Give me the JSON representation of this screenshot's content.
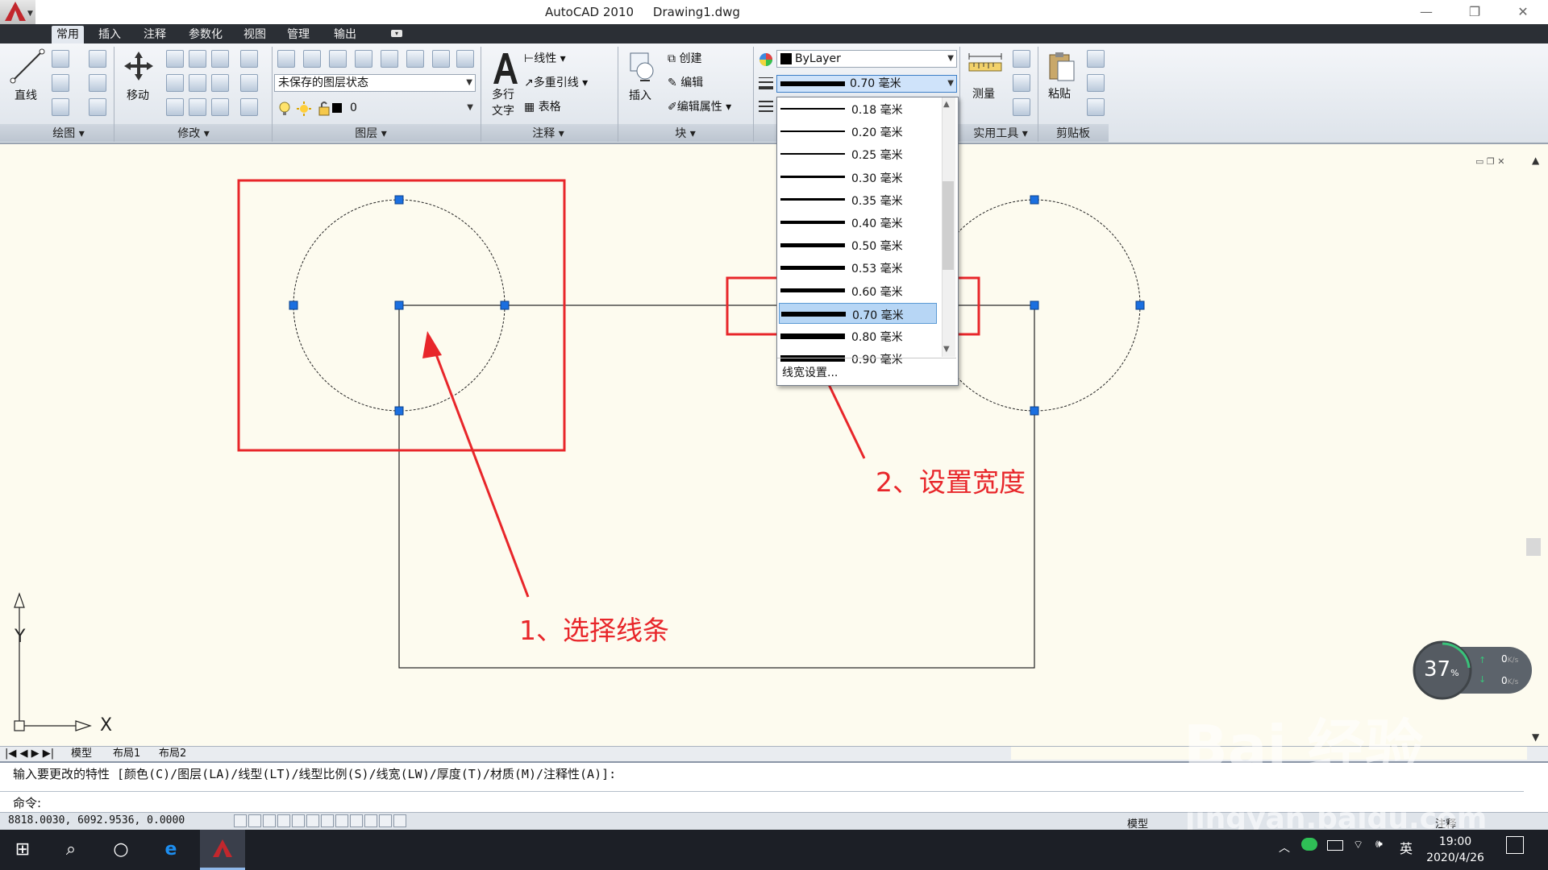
{
  "window": {
    "title": "AutoCAD 2010     Drawing1.dwg",
    "minimize": "—",
    "restore": "❐",
    "close": "✕"
  },
  "ribbon_tabs": [
    "常用",
    "插入",
    "注释",
    "参数化",
    "视图",
    "管理",
    "输出"
  ],
  "ribbon": {
    "draw": {
      "line_label": "直线",
      "panel_label": "绘图"
    },
    "modify": {
      "move_label": "移动",
      "panel_label": "修改"
    },
    "layers": {
      "state_combo": "未保存的图层状态",
      "layer_combo": "0",
      "panel_label": "图层"
    },
    "annotation": {
      "mtext_label_1": "多行",
      "mtext_label_2": "文字",
      "linear_label": "线性",
      "mleader_label": "多重引线",
      "table_label": "表格",
      "panel_label": "注释"
    },
    "block": {
      "insert_label": "插入",
      "create_label": "创建",
      "edit_label": "编辑",
      "edit_attr_label": "编辑属性",
      "panel_label": "块"
    },
    "properties": {
      "color_combo": "ByLayer",
      "lineweight_combo": "0.70 毫米"
    },
    "utilities": {
      "measure_label": "测量",
      "panel_label": "实用工具"
    },
    "clipboard": {
      "paste_label": "粘贴",
      "panel_label": "剪贴板"
    }
  },
  "lineweight_dropdown": {
    "items": [
      {
        "label": "0.18 毫米",
        "value": 0.18
      },
      {
        "label": "0.20 毫米",
        "value": 0.2
      },
      {
        "label": "0.25 毫米",
        "value": 0.25
      },
      {
        "label": "0.30 毫米",
        "value": 0.3
      },
      {
        "label": "0.35 毫米",
        "value": 0.35
      },
      {
        "label": "0.40 毫米",
        "value": 0.4
      },
      {
        "label": "0.50 毫米",
        "value": 0.5
      },
      {
        "label": "0.53 毫米",
        "value": 0.53
      },
      {
        "label": "0.60 毫米",
        "value": 0.6
      },
      {
        "label": "0.70 毫米",
        "value": 0.7
      },
      {
        "label": "0.80 毫米",
        "value": 0.8
      },
      {
        "label": "0.90 毫米",
        "value": 0.9
      }
    ],
    "selected": "0.70 毫米",
    "settings_label": "线宽设置..."
  },
  "annotations": {
    "step1": "1、选择线条",
    "step2": "2、设置宽度",
    "color": "#e8262a"
  },
  "ucs": {
    "x_label": "X",
    "y_label": "Y"
  },
  "layout_tabs": [
    "模型",
    "布局1",
    "布局2"
  ],
  "command": {
    "history": "输入要更改的特性 [颜色(C)/图层(LA)/线型(LT)/线型比例(S)/线宽(LW)/厚度(T)/材质(M)/注释性(A)]:",
    "prompt": "命令:"
  },
  "status": {
    "coords": "8818.0030,  6092.9536, 0.0000",
    "model_label": "模型",
    "annotation_label": "注释"
  },
  "speed_widget": {
    "percent": "37",
    "percent_unit": "%",
    "up": "0",
    "down": "0",
    "unit": "K/s"
  },
  "taskbar": {
    "time": "19:00",
    "date": "2020/4/26",
    "ime": "英"
  },
  "watermark": {
    "text": "Bai 经验",
    "url": "jingyan.baidu.com"
  }
}
